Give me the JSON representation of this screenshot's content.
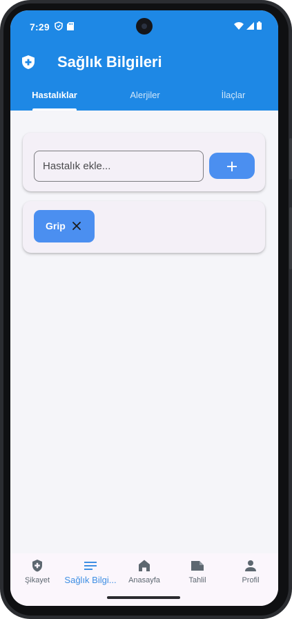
{
  "status_bar": {
    "time": "7:29"
  },
  "header": {
    "title": "Sağlık Bilgileri"
  },
  "tabs": [
    {
      "label": "Hastalıklar",
      "active": true
    },
    {
      "label": "Alerjiler",
      "active": false
    },
    {
      "label": "İlaçlar",
      "active": false
    }
  ],
  "add_form": {
    "placeholder": "Hastalık ekle...",
    "value": "",
    "add_button_icon": "plus-icon"
  },
  "diseases": [
    {
      "label": "Grip",
      "remove_icon": "close-icon"
    }
  ],
  "bottom_nav": [
    {
      "label": "Şikayet",
      "icon": "shield-plus-icon",
      "active": false
    },
    {
      "label": "Sağlık Bilgi...",
      "icon": "list-icon",
      "active": true
    },
    {
      "label": "Anasayfa",
      "icon": "home-icon",
      "active": false
    },
    {
      "label": "Tahlil",
      "icon": "label-icon",
      "active": false
    },
    {
      "label": "Profil",
      "icon": "person-icon",
      "active": false
    }
  ],
  "colors": {
    "app_bar": "#1e88e5",
    "accent": "#4b8ff0",
    "background": "#f5f5f9",
    "card": "#f4f0f7",
    "nav_active": "#3d8ee3"
  }
}
